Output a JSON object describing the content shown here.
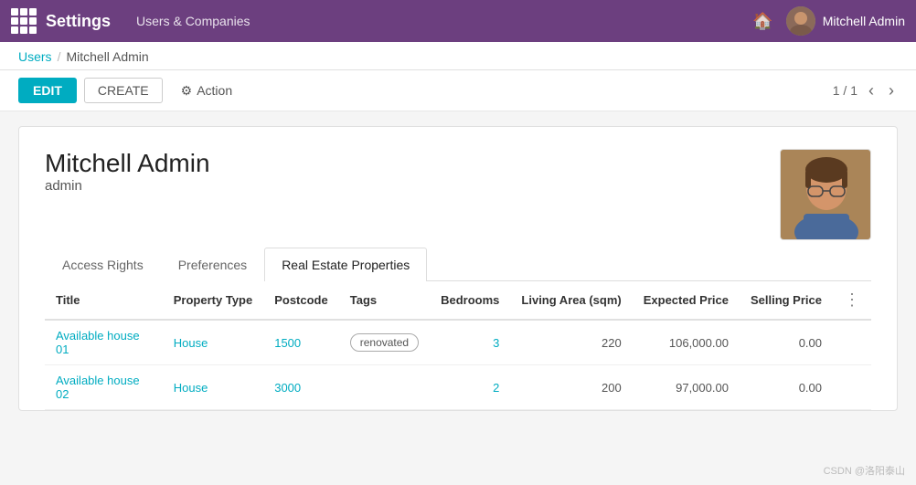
{
  "nav": {
    "title": "Settings",
    "menu_items": [
      "Users & Companies"
    ],
    "user_name": "Mitchell Admin",
    "icons": {
      "grid": "grid-icon",
      "home": "🏠",
      "caret": "▾"
    }
  },
  "breadcrumb": {
    "parent": "Users",
    "separator": "/",
    "current": "Mitchell Admin"
  },
  "toolbar": {
    "edit_label": "EDIT",
    "create_label": "CREATE",
    "action_label": "Action",
    "action_icon": "⚙",
    "pagination": "1 / 1"
  },
  "record": {
    "name": "Mitchell Admin",
    "login": "admin",
    "avatar_alt": "Mitchell Admin avatar"
  },
  "tabs": [
    {
      "label": "Access Rights",
      "active": false
    },
    {
      "label": "Preferences",
      "active": false
    },
    {
      "label": "Real Estate Properties",
      "active": true
    }
  ],
  "table": {
    "columns": [
      {
        "label": "Title",
        "align": "left"
      },
      {
        "label": "Property Type",
        "align": "left"
      },
      {
        "label": "Postcode",
        "align": "left"
      },
      {
        "label": "Tags",
        "align": "left"
      },
      {
        "label": "Bedrooms",
        "align": "right"
      },
      {
        "label": "Living Area (sqm)",
        "align": "right"
      },
      {
        "label": "Expected Price",
        "align": "right"
      },
      {
        "label": "Selling Price",
        "align": "right"
      }
    ],
    "rows": [
      {
        "title": "Available house 01",
        "property_type": "House",
        "postcode": "1500",
        "tags": [
          "renovated"
        ],
        "bedrooms": "3",
        "living_area": "220",
        "expected_price": "106,000.00",
        "selling_price": "0.00"
      },
      {
        "title": "Available house 02",
        "property_type": "House",
        "postcode": "3000",
        "tags": [],
        "bedrooms": "2",
        "living_area": "200",
        "expected_price": "97,000.00",
        "selling_price": "0.00"
      }
    ]
  },
  "watermark": "CSDN @洛阳泰山"
}
